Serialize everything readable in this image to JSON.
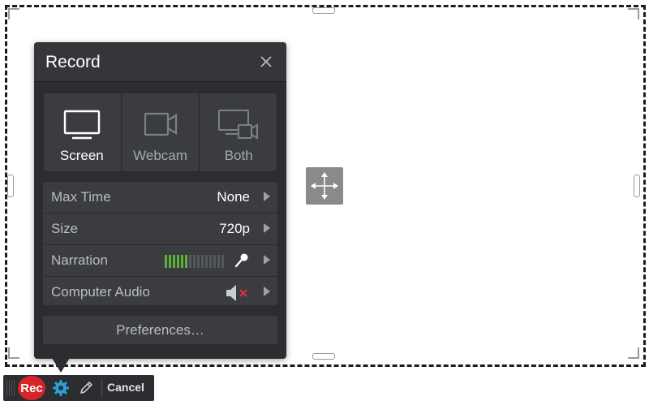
{
  "panel": {
    "title": "Record",
    "close_icon": "close-icon",
    "sources": [
      {
        "label": "Screen",
        "icon": "monitor-icon",
        "active": true
      },
      {
        "label": "Webcam",
        "icon": "webcam-icon",
        "active": false
      },
      {
        "label": "Both",
        "icon": "screen-and-webcam-icon",
        "active": false
      }
    ],
    "settings": [
      {
        "label": "Max Time",
        "value": "None"
      },
      {
        "label": "Size",
        "value": "720p"
      },
      {
        "label": "Narration",
        "level_bars_on": 6,
        "level_bars_total": 15,
        "icon": "microphone-icon"
      },
      {
        "label": "Computer Audio",
        "icon": "speaker-muted-icon"
      }
    ],
    "preferences_label": "Preferences…"
  },
  "toolbar": {
    "rec_label": "Rec",
    "settings_icon": "gear-icon",
    "draw_icon": "pencil-icon",
    "cancel_label": "Cancel"
  },
  "colors": {
    "panel_bg": "#2b2d30",
    "rec_red": "#d6242a",
    "meter_green": "#58b23c",
    "mute_red": "#e0333a",
    "gear_blue": "#2a9fd8"
  }
}
